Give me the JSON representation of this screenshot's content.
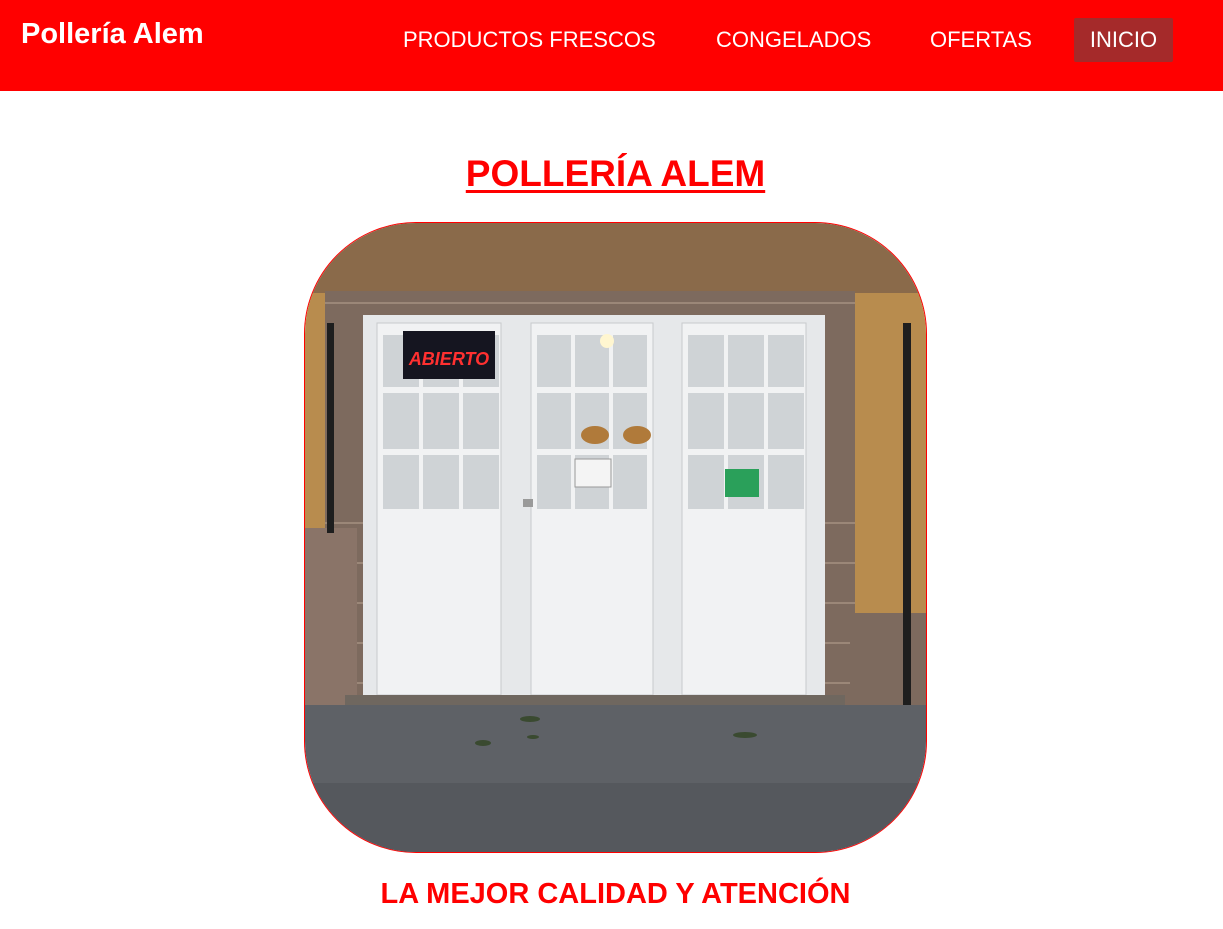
{
  "navbar": {
    "brand": "Pollería Alem",
    "links": [
      {
        "label": "PRODUCTOS FRESCOS"
      },
      {
        "label": "CONGELADOS"
      },
      {
        "label": "OFERTAS"
      },
      {
        "label": "INICIO",
        "active": true
      }
    ]
  },
  "main": {
    "title": "POLLERÍA ALEM",
    "photo": {
      "subject": "storefront-white-doors",
      "sign_text": "ABIERTO"
    },
    "tagline": "LA MEJOR CALIDAD Y ATENCIÓN"
  },
  "colors": {
    "brand_red": "#ff0000",
    "active_nav": "#a52a2a",
    "text_light": "#ffffff"
  }
}
